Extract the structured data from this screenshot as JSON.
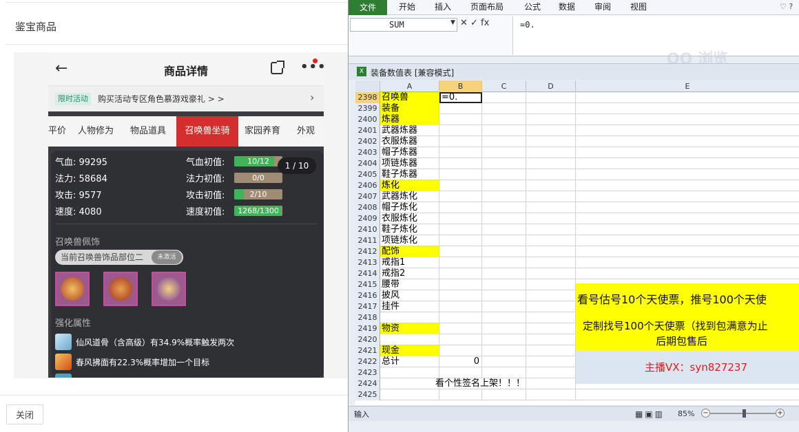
{
  "dialog": {
    "title": "鉴宝商品",
    "close_label": "关闭"
  },
  "phone": {
    "title": "商品详情",
    "promo_tag": "限时活动",
    "promo_text": "购买活动专区角色慕游戏豪礼 > >",
    "tabs": [
      "平价",
      "人物修为",
      "物品道具",
      "召唤兽坐骑",
      "家园养育",
      "外观"
    ],
    "active_tab": "召唤兽坐骑",
    "page_indicator": "1 / 10",
    "stats": [
      {
        "label": "气血: 99295",
        "init_label": "气血初值:",
        "bar_text": "10/12",
        "fill": 0.83
      },
      {
        "label": "法力: 58684",
        "init_label": "法力初值:",
        "bar_text": "0/0",
        "fill": 0
      },
      {
        "label": "攻击: 9577",
        "init_label": "攻击初值:",
        "bar_text": "2/10",
        "fill": 0.2
      },
      {
        "label": "速度: 4080",
        "init_label": "速度初值:",
        "bar_text": "1268/1300",
        "fill": 0.975
      }
    ],
    "ornament_section": "召唤兽佩饰",
    "ornament_pill": "当前召唤兽饰品部位二",
    "ornament_badge": "未激活",
    "enhance_section": "强化属性",
    "skills": [
      "仙风道骨（含高级）有34.9%概率触发两次",
      "春风拂面有22.3%概率增加一个目标"
    ]
  },
  "excel": {
    "ribbon_tabs": [
      "文件",
      "开始",
      "插入",
      "页面布局",
      "公式",
      "数据",
      "审阅",
      "视图"
    ],
    "name_box": "SUM",
    "formula_buttons": "✕ ✓ fx",
    "formula": "=0.",
    "watermark": "QQ 浏览",
    "doc_title": "装备数值表 [兼容模式]",
    "columns": [
      "A",
      "B",
      "C",
      "D",
      "E"
    ],
    "rows": [
      {
        "n": "2398",
        "a": "召唤兽",
        "b": "=0.",
        "y": true
      },
      {
        "n": "2399",
        "a": "装备",
        "y": true
      },
      {
        "n": "2400",
        "a": "炼器",
        "y": true
      },
      {
        "n": "2401",
        "a": "武器炼器"
      },
      {
        "n": "2402",
        "a": "衣服炼器"
      },
      {
        "n": "2403",
        "a": "帽子炼器"
      },
      {
        "n": "2404",
        "a": "项链炼器"
      },
      {
        "n": "2405",
        "a": "鞋子炼器"
      },
      {
        "n": "2406",
        "a": "炼化",
        "y": true
      },
      {
        "n": "2407",
        "a": "武器炼化"
      },
      {
        "n": "2408",
        "a": "帽子炼化"
      },
      {
        "n": "2409",
        "a": "衣服炼化"
      },
      {
        "n": "2410",
        "a": "鞋子炼化"
      },
      {
        "n": "2411",
        "a": "项链炼化"
      },
      {
        "n": "2412",
        "a": "配饰",
        "y": true
      },
      {
        "n": "2413",
        "a": "戒指1"
      },
      {
        "n": "2414",
        "a": "戒指2"
      },
      {
        "n": "2415",
        "a": "腰带"
      },
      {
        "n": "2416",
        "a": "披风"
      },
      {
        "n": "2417",
        "a": "挂件"
      },
      {
        "n": "2418",
        "a": ""
      },
      {
        "n": "2419",
        "a": "物资",
        "y": true
      },
      {
        "n": "2420",
        "a": ""
      },
      {
        "n": "2421",
        "a": "现金",
        "y": true
      },
      {
        "n": "2422",
        "a": "总计",
        "b": "0",
        "bright": true
      },
      {
        "n": "2423",
        "a": ""
      },
      {
        "n": "2424",
        "a": "",
        "b": "看个性签名上架！！！"
      },
      {
        "n": "2425",
        "a": ""
      }
    ],
    "banner1": "看号估号10个天使票，推号100个天使",
    "banner2_line1": "定制找号100个天使票（找到包满意为止",
    "banner2_line2": "后期包售后",
    "banner3": "主播VX：syn827237",
    "status_mode": "输入",
    "zoom": "85%"
  }
}
